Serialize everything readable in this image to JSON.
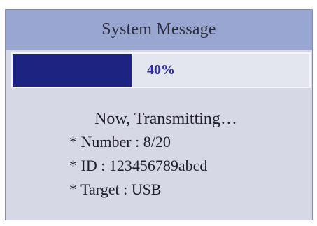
{
  "dialog": {
    "title": "System Message",
    "progress": {
      "percent": 40,
      "label": "40%"
    },
    "status": "Now, Transmitting…",
    "info": [
      "* Number : 8/20",
      "* ID : 123456789abcd",
      "* Target : USB"
    ]
  },
  "colors": {
    "title_bar": "#9aa6d2",
    "dialog_background": "#d6d8e6",
    "progress_fill": "#1d2380",
    "progress_label": "#2d2e9a"
  }
}
